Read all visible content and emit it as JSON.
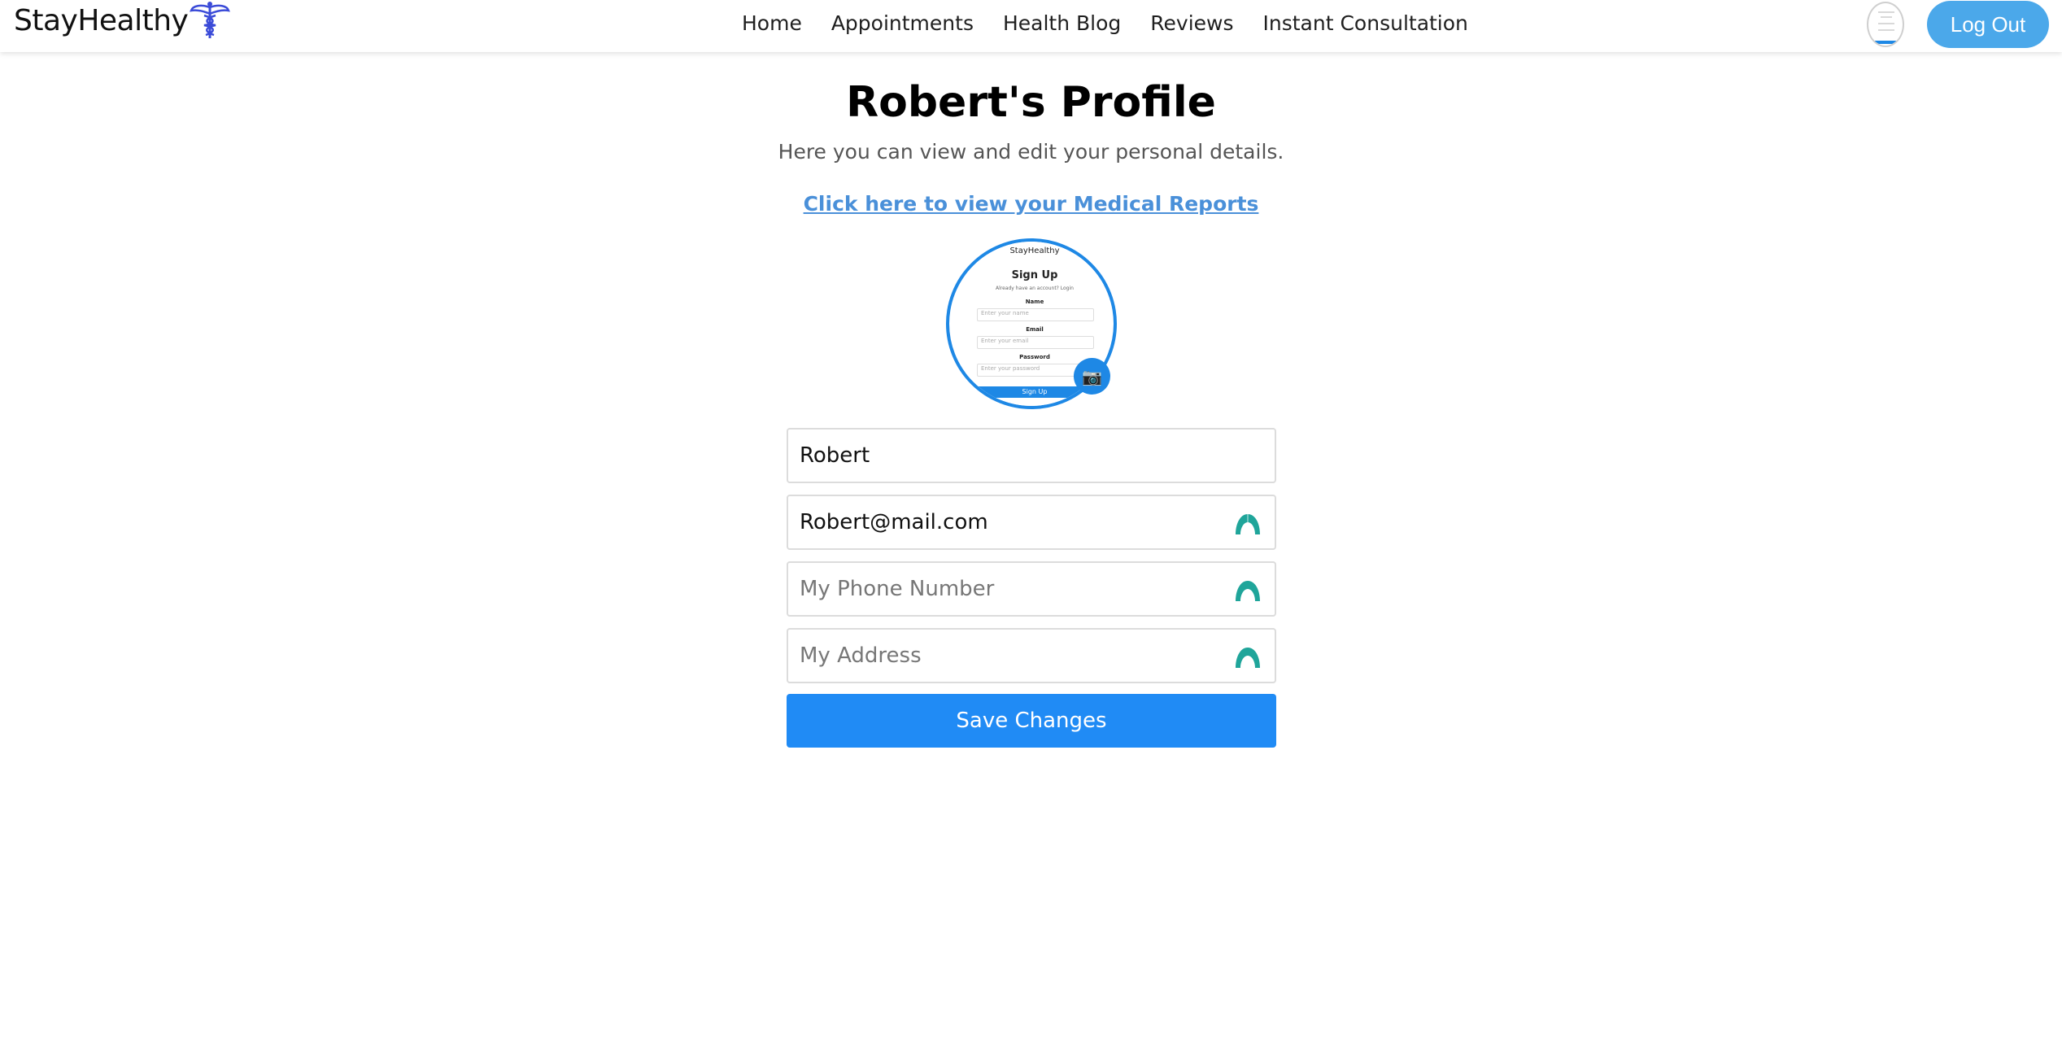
{
  "brand": {
    "name": "StayHealthy"
  },
  "nav": {
    "links": [
      "Home",
      "Appointments",
      "Health Blog",
      "Reviews",
      "Instant Consultation"
    ],
    "logout_label": "Log Out"
  },
  "profile": {
    "title": "Robert's Profile",
    "subtitle": "Here you can view and edit your personal details.",
    "reports_link": "Click here to view your Medical Reports",
    "picture_preview": {
      "brand": "StayHealthy",
      "heading": "Sign Up",
      "login_prompt": "Already have an account? Login",
      "name_label": "Name",
      "name_placeholder": "Enter your name",
      "email_label": "Email",
      "email_placeholder": "Enter your email",
      "password_label": "Password",
      "password_placeholder": "Enter your password",
      "button": "Sign Up"
    }
  },
  "form": {
    "name": {
      "value": "Robert",
      "placeholder": ""
    },
    "email": {
      "value": "Robert@mail.com",
      "placeholder": ""
    },
    "phone": {
      "value": "",
      "placeholder": "My Phone Number"
    },
    "address": {
      "value": "",
      "placeholder": "My Address"
    },
    "save_label": "Save Changes"
  },
  "colors": {
    "accent": "#208bf5",
    "link": "#4a90d9",
    "logout": "#4ba8ea",
    "field_icon": "#1fa59a"
  }
}
